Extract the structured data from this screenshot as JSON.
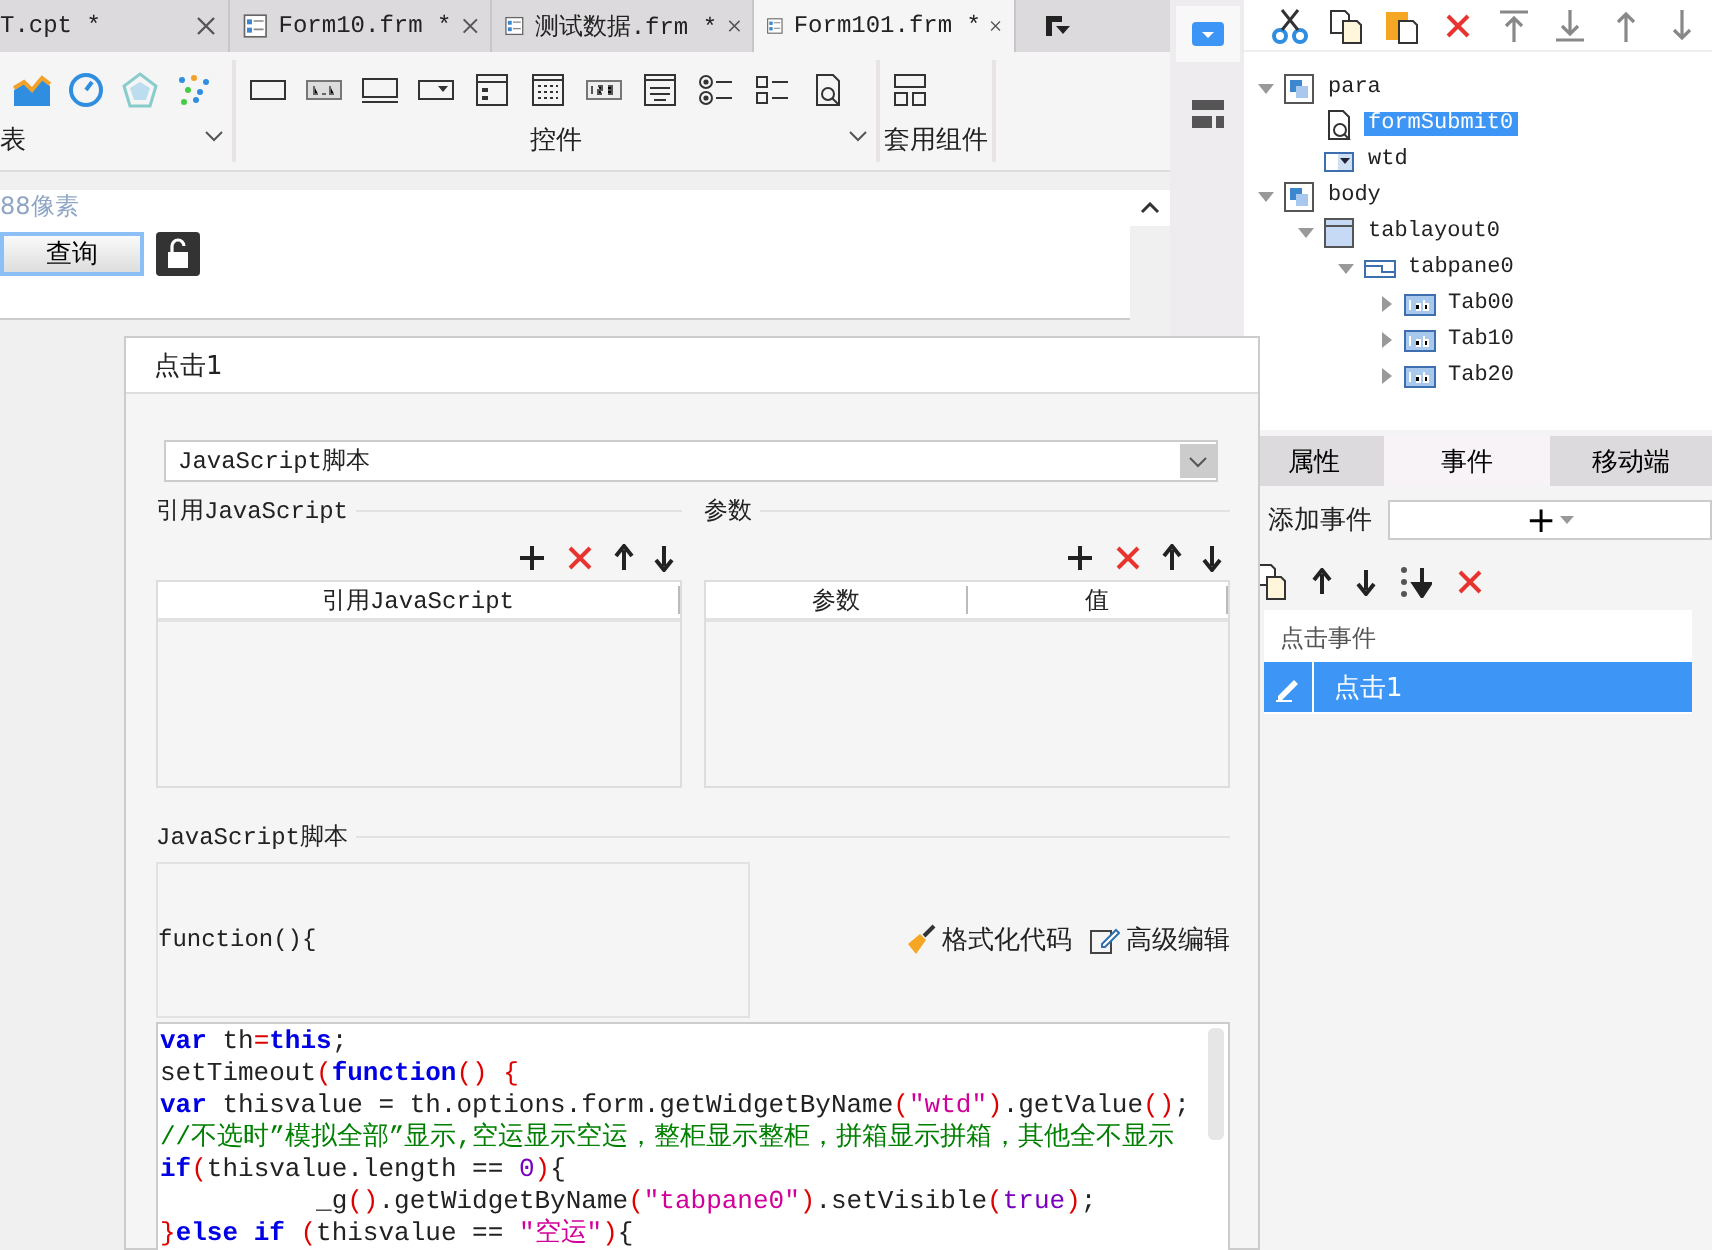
{
  "tabs": [
    {
      "label": "T.cpt *",
      "selected": false,
      "icon": false
    },
    {
      "label": "Form10.frm *",
      "selected": false,
      "icon": true
    },
    {
      "label": "测试数据.frm *",
      "selected": false,
      "icon": true
    },
    {
      "label": "Form101.frm *",
      "selected": true,
      "icon": true
    }
  ],
  "ribbon": {
    "groups": [
      {
        "label": "表",
        "kind": "charts"
      },
      {
        "label": "控件",
        "kind": "widgets"
      },
      {
        "label": "套用组件",
        "kind": "templates"
      }
    ]
  },
  "canvas": {
    "hint": "88像素",
    "button": "查询"
  },
  "tree": [
    {
      "label": "para",
      "kind": "container",
      "toggle": true,
      "expanded": true,
      "selected": false,
      "children": [
        {
          "label": "formSubmit0",
          "kind": "search",
          "toggle": false,
          "selected": true
        },
        {
          "label": "wtd",
          "kind": "combo",
          "toggle": false,
          "selected": false
        }
      ]
    },
    {
      "label": "body",
      "kind": "container",
      "toggle": true,
      "expanded": true,
      "selected": false,
      "children": [
        {
          "label": "tablayout0",
          "kind": "layout",
          "toggle": true,
          "expanded": true,
          "selected": false,
          "children": [
            {
              "label": "tabpane0",
              "kind": "tabpane",
              "toggle": true,
              "expanded": true,
              "selected": false,
              "children": [
                {
                  "label": "Tab00",
                  "kind": "tab",
                  "toggle": true,
                  "expanded": false,
                  "selected": false
                },
                {
                  "label": "Tab10",
                  "kind": "tab",
                  "toggle": true,
                  "expanded": false,
                  "selected": false
                },
                {
                  "label": "Tab20",
                  "kind": "tab",
                  "toggle": true,
                  "expanded": false,
                  "selected": false
                }
              ]
            }
          ]
        }
      ]
    }
  ],
  "panel_tabs": [
    {
      "label": "属性",
      "selected": false
    },
    {
      "label": "事件",
      "selected": true
    },
    {
      "label": "移动端",
      "selected": false
    }
  ],
  "add_event": {
    "label": "添加事件",
    "button": "+"
  },
  "event_list": {
    "header": "点击事件",
    "items": [
      {
        "label": "点击1",
        "selected": true
      }
    ]
  },
  "dialog": {
    "title": "点击1",
    "type_select": "JavaScript脚本",
    "imports": {
      "legend": "引用JavaScript",
      "columns": [
        "引用JavaScript"
      ]
    },
    "params": {
      "legend": "参数",
      "columns": [
        "参数",
        "值"
      ]
    },
    "script": {
      "legend": "JavaScript脚本",
      "signature": "function(){",
      "format_button": "格式化代码",
      "advanced_button": "高级编辑",
      "lines": [
        [
          {
            "kind": "kw",
            "text": "var"
          },
          {
            "kind": "plain",
            "text": " th"
          },
          {
            "kind": "op",
            "text": "="
          },
          {
            "kind": "kw",
            "text": "this"
          },
          {
            "kind": "plain",
            "text": ";"
          }
        ],
        [
          {
            "kind": "plain",
            "text": "setTimeout"
          },
          {
            "kind": "op",
            "text": "("
          },
          {
            "kind": "kw",
            "text": "function"
          },
          {
            "kind": "op",
            "text": "() {"
          }
        ],
        [
          {
            "kind": "kw",
            "text": "var"
          },
          {
            "kind": "plain",
            "text": " thisvalue = th.options.form.getWidgetByName"
          },
          {
            "kind": "op",
            "text": "("
          },
          {
            "kind": "str",
            "text": "\"wtd\""
          },
          {
            "kind": "op",
            "text": ")"
          },
          {
            "kind": "plain",
            "text": ".getValue"
          },
          {
            "kind": "op",
            "text": "()"
          },
          {
            "kind": "plain",
            "text": ";"
          }
        ],
        [
          {
            "kind": "comment",
            "text": "//不选时”模拟全部”显示,空运显示空运，整柜显示整柜，拼箱显示拼箱，其他全不显示"
          }
        ],
        [
          {
            "kind": "kw",
            "text": "if"
          },
          {
            "kind": "op",
            "text": "("
          },
          {
            "kind": "plain",
            "text": "thisvalue.length == "
          },
          {
            "kind": "num",
            "text": "0"
          },
          {
            "kind": "op",
            "text": ")"
          },
          {
            "kind": "plain",
            "text": "{"
          }
        ],
        [
          {
            "kind": "plain",
            "text": "          _g"
          },
          {
            "kind": "op",
            "text": "()"
          },
          {
            "kind": "plain",
            "text": ".getWidgetByName"
          },
          {
            "kind": "op",
            "text": "("
          },
          {
            "kind": "str",
            "text": "\"tabpane0\""
          },
          {
            "kind": "op",
            "text": ")"
          },
          {
            "kind": "plain",
            "text": ".setVisible"
          },
          {
            "kind": "op",
            "text": "("
          },
          {
            "kind": "num",
            "text": "true"
          },
          {
            "kind": "op",
            "text": ")"
          },
          {
            "kind": "plain",
            "text": ";"
          }
        ],
        [
          {
            "kind": "op",
            "text": "}"
          },
          {
            "kind": "kw",
            "text": "else if"
          },
          {
            "kind": "op",
            "text": " ("
          },
          {
            "kind": "plain",
            "text": "thisvalue == "
          },
          {
            "kind": "str",
            "text": "\"空运\""
          },
          {
            "kind": "op",
            "text": ")"
          },
          {
            "kind": "plain",
            "text": "{"
          }
        ]
      ]
    }
  }
}
